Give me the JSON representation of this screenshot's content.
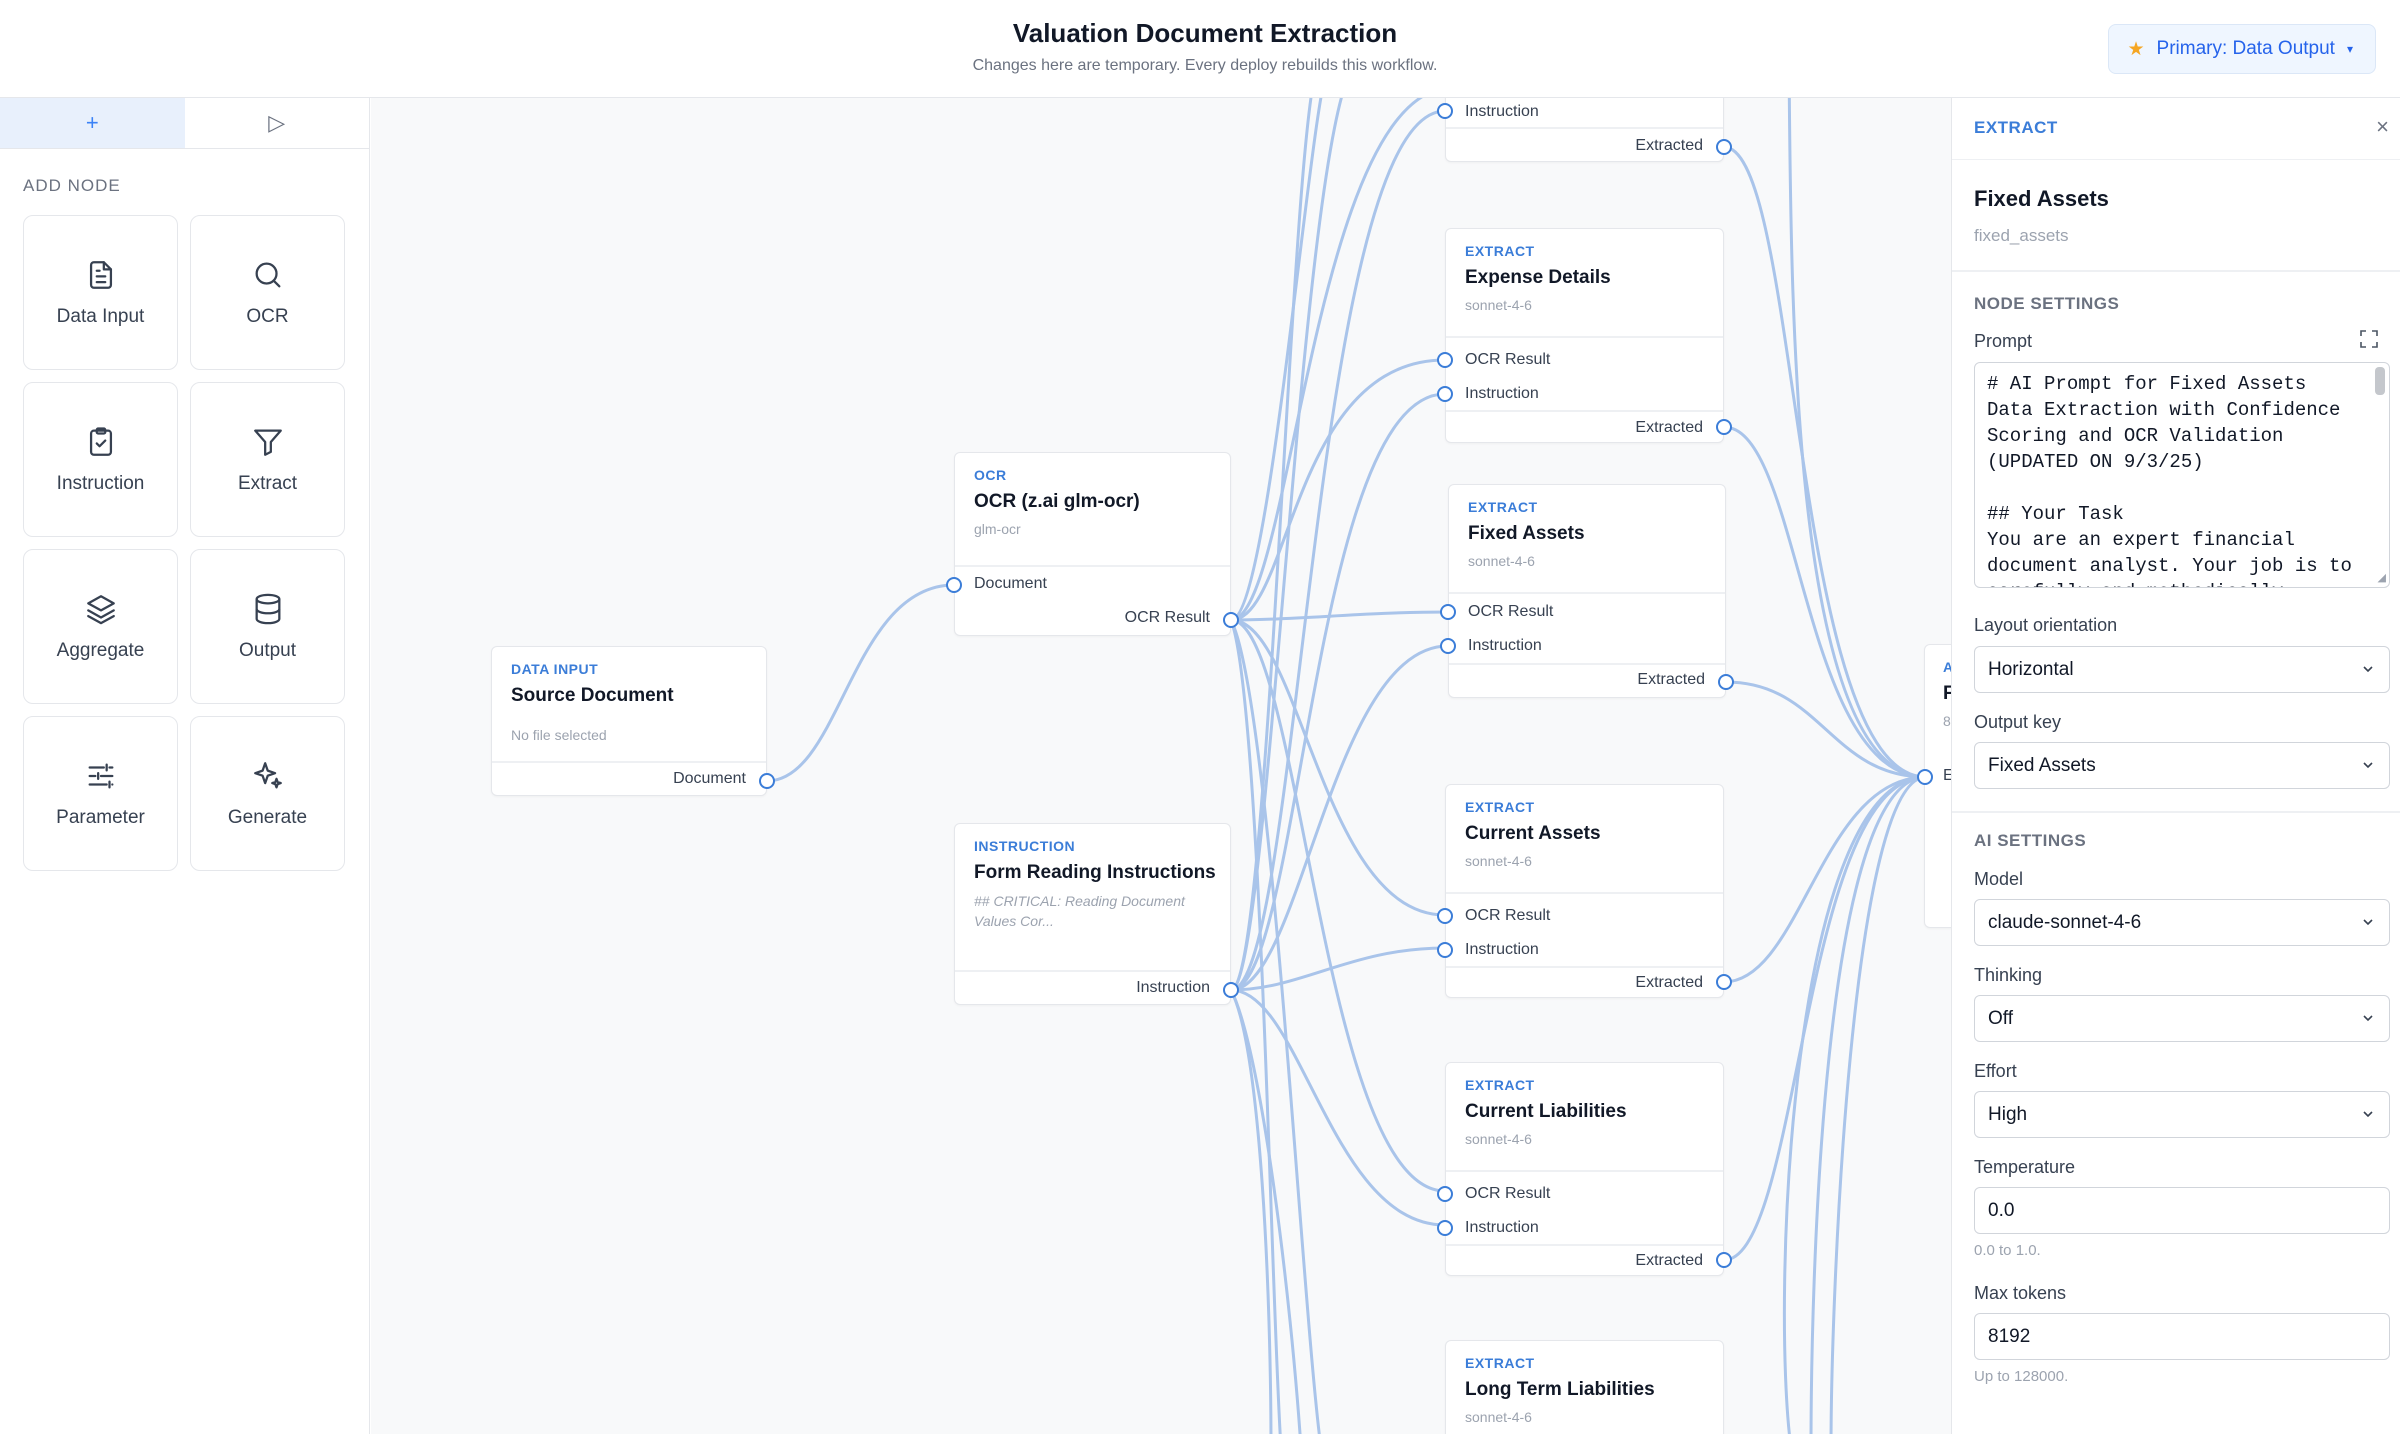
{
  "header": {
    "title": "Valuation Document Extraction",
    "subtitle": "Changes here are temporary. Every deploy rebuilds this workflow.",
    "primary_label": "Primary: Data Output",
    "primary_icon": "star-icon",
    "accent_color": "#2563eb"
  },
  "sidebar": {
    "tabs": [
      {
        "label": "+",
        "icon": "plus-icon",
        "active": true
      },
      {
        "label": "▷",
        "icon": "play-icon",
        "active": false
      }
    ],
    "section_label": "ADD NODE",
    "node_types": [
      {
        "label": "Data Input",
        "icon": "document-icon"
      },
      {
        "label": "OCR",
        "icon": "search-icon"
      },
      {
        "label": "Instruction",
        "icon": "clipboard-check-icon"
      },
      {
        "label": "Extract",
        "icon": "filter-icon"
      },
      {
        "label": "Aggregate",
        "icon": "layers-icon"
      },
      {
        "label": "Output",
        "icon": "database-icon"
      },
      {
        "label": "Parameter",
        "icon": "sliders-icon"
      },
      {
        "label": "Generate",
        "icon": "sparkles-icon"
      }
    ]
  },
  "canvas": {
    "nodes": {
      "data_input": {
        "type": "DATA INPUT",
        "title": "Source Document",
        "subtitle": "No file selected",
        "outputs": [
          "Document"
        ]
      },
      "ocr": {
        "type": "OCR",
        "title": "OCR (z.ai glm-ocr)",
        "subtitle": "glm-ocr",
        "inputs": [
          "Document"
        ],
        "outputs": [
          "OCR Result"
        ]
      },
      "instruction": {
        "type": "INSTRUCTION",
        "title": "Form Reading Instructions",
        "subtitle": "## CRITICAL: Reading Document Values Cor...",
        "outputs": [
          "Instruction"
        ]
      },
      "top_partial": {
        "inputs": [
          "Instruction"
        ],
        "outputs": [
          "Extracted"
        ]
      },
      "expense_details": {
        "type": "EXTRACT",
        "title": "Expense Details",
        "subtitle": "sonnet-4-6",
        "inputs": [
          "OCR Result",
          "Instruction"
        ],
        "outputs": [
          "Extracted"
        ]
      },
      "fixed_assets": {
        "type": "EXTRACT",
        "title": "Fixed Assets",
        "subtitle": "sonnet-4-6",
        "inputs": [
          "OCR Result",
          "Instruction"
        ],
        "outputs": [
          "Extracted"
        ]
      },
      "current_assets": {
        "type": "EXTRACT",
        "title": "Current Assets",
        "subtitle": "sonnet-4-6",
        "inputs": [
          "OCR Result",
          "Instruction"
        ],
        "outputs": [
          "Extracted"
        ]
      },
      "current_liabilities": {
        "type": "EXTRACT",
        "title": "Current Liabilities",
        "subtitle": "sonnet-4-6",
        "inputs": [
          "OCR Result",
          "Instruction"
        ],
        "outputs": [
          "Extracted"
        ]
      },
      "long_term_liabilities": {
        "type": "EXTRACT",
        "title": "Long Term Liabilities",
        "subtitle": "sonnet-4-6"
      },
      "aggregate_partial": {
        "type": "A",
        "title": "F",
        "subtitle": "8",
        "input_label": "E"
      }
    },
    "wire_color": "#a9c4ea",
    "port_color": "#3b7dd8"
  },
  "inspector": {
    "type": "EXTRACT",
    "close_label": "×",
    "title": "Fixed Assets",
    "key": "fixed_assets",
    "node_settings_label": "NODE SETTINGS",
    "prompt_label": "Prompt",
    "prompt_value": "# AI Prompt for Fixed Assets Data Extraction with Confidence Scoring and OCR Validation (UPDATED ON 9/3/25)\n\n## Your Task\nYou are an expert financial document analyst. Your job is to carefully and methodically",
    "layout_label": "Layout orientation",
    "layout_value": "Horizontal",
    "output_key_label": "Output key",
    "output_key_value": "Fixed Assets",
    "ai_settings_label": "AI SETTINGS",
    "model_label": "Model",
    "model_value": "claude-sonnet-4-6",
    "thinking_label": "Thinking",
    "thinking_value": "Off",
    "effort_label": "Effort",
    "effort_value": "High",
    "temperature_label": "Temperature",
    "temperature_value": "0.0",
    "temperature_hint": "0.0 to 1.0.",
    "max_tokens_label": "Max tokens",
    "max_tokens_value": "8192",
    "max_tokens_hint": "Up to 128000."
  }
}
